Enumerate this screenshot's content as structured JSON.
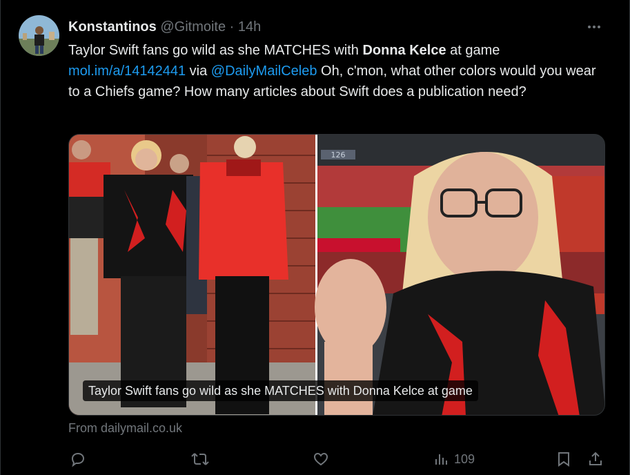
{
  "tweet": {
    "author_name": "Konstantinos",
    "author_handle": "@Gitmoite",
    "separator": "·",
    "time": "14h",
    "text_line1_prefix": "Taylor Swift fans go wild as she MATCHES with ",
    "text_bold": "Donna Kelce",
    "text_line1_suffix": " at game",
    "link_url": "mol.im/a/14142441",
    "via": " via ",
    "mention": "@DailyMailCeleb",
    "text_rest": " Oh, c'mon, what other colors would you wear to a Chiefs game? How many articles about Swift does a publication need?"
  },
  "card": {
    "title": "Taylor Swift fans go wild as she MATCHES with Donna Kelce at game",
    "source": "From dailymail.co.uk",
    "stadium_sign": "126"
  },
  "actions": {
    "views_count": "109"
  },
  "icons": {
    "more": "more-dots-icon",
    "reply": "reply-icon",
    "retweet": "retweet-icon",
    "like": "like-icon",
    "views": "views-chart-icon",
    "bookmark": "bookmark-icon",
    "share": "share-icon"
  },
  "colors": {
    "background": "#000000",
    "text": "#e7e9ea",
    "muted": "#71767b",
    "link": "#1d9bf0",
    "chiefs_red": "#e31837"
  }
}
